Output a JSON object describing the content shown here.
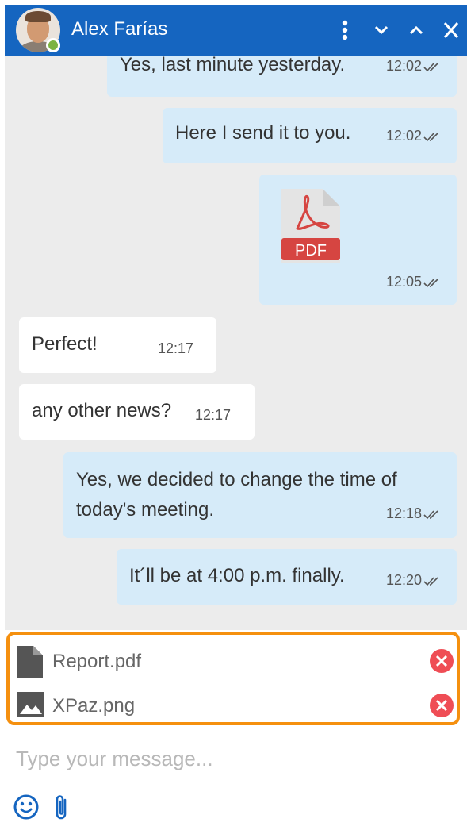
{
  "header": {
    "contact_name": "Alex Farías",
    "presence": "online",
    "icons": [
      "more-vertical-icon",
      "chevron-down-icon",
      "chevron-up-icon",
      "close-icon"
    ]
  },
  "messages": [
    {
      "direction": "out",
      "text": "Yes, last minute yesterday.",
      "time": "12:02",
      "read": true
    },
    {
      "direction": "out",
      "text": "Here I send it to you.",
      "time": "12:02",
      "read": true
    },
    {
      "direction": "out",
      "type": "file",
      "file_label": "PDF",
      "time": "12:05",
      "read": true
    },
    {
      "direction": "in",
      "text": "Perfect!",
      "time": "12:17"
    },
    {
      "direction": "in",
      "text": "any other news?",
      "time": "12:17"
    },
    {
      "direction": "out",
      "text_line1": "Yes, we decided to change the time of",
      "text_line2": "today's meeting.",
      "time": "12:18",
      "read": true
    },
    {
      "direction": "out",
      "text": "It´ll be at 4:00 p.m. finally.",
      "time": "12:20",
      "read": true
    }
  ],
  "attachments": [
    {
      "name": "Report.pdf",
      "icon": "file-icon"
    },
    {
      "name": "XPaz.png",
      "icon": "image-icon"
    }
  ],
  "composer": {
    "placeholder": "Type your message...",
    "value": ""
  },
  "toolbar": {
    "icons": [
      "emoji-icon",
      "paperclip-icon"
    ]
  },
  "colors": {
    "header": "#1565c0",
    "outgoing_bubble": "#d6ebf9",
    "incoming_bubble": "#ffffff",
    "chat_background": "#ececec",
    "attachments_border": "#f5900f",
    "remove_button": "#ef4d55",
    "presence": "#7cb342"
  }
}
